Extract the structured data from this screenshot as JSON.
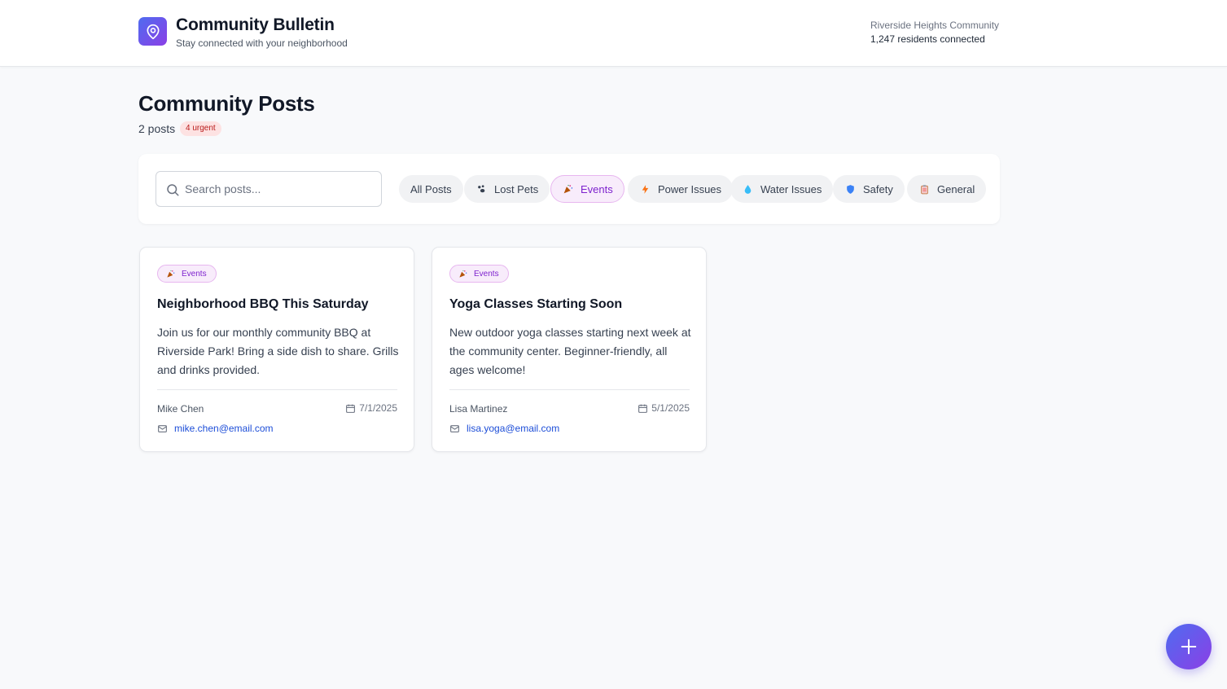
{
  "header": {
    "title": "Community Bulletin",
    "subtitle": "Stay connected with your neighborhood",
    "community_name": "Riverside Heights Community",
    "residents": "1,247 residents connected"
  },
  "main": {
    "title": "Community Posts",
    "post_count": "2 posts",
    "urgent_badge": "4 urgent"
  },
  "search": {
    "placeholder": "Search posts...",
    "value": ""
  },
  "filters": [
    {
      "label": "All Posts",
      "icon": "none",
      "active": false
    },
    {
      "label": "Lost Pets",
      "icon": "paw-icon",
      "active": false
    },
    {
      "label": "Events",
      "icon": "party-popper-icon",
      "active": true
    },
    {
      "label": "Power Issues",
      "icon": "lightning-icon",
      "active": false
    },
    {
      "label": "Water Issues",
      "icon": "droplet-icon",
      "active": false
    },
    {
      "label": "Safety",
      "icon": "shield-icon",
      "active": false
    },
    {
      "label": "General",
      "icon": "clipboard-icon",
      "active": false
    }
  ],
  "posts": [
    {
      "category": "Events",
      "title": "Neighborhood BBQ This Saturday",
      "body": "Join us for our monthly community BBQ at Riverside Park! Bring a side dish to share. Grills and drinks provided.",
      "author": "Mike Chen",
      "date": "7/1/2025",
      "email": "mike.chen@email.com"
    },
    {
      "category": "Events",
      "title": "Yoga Classes Starting Soon",
      "body": "New outdoor yoga classes starting next week at the community center. Beginner-friendly, all ages welcome!",
      "author": "Lisa Martinez",
      "date": "5/1/2025",
      "email": "lisa.yoga@email.com"
    }
  ],
  "colors": {
    "accent_start": "#4f6cf0",
    "accent_end": "#8b3fe6",
    "events_bg": "#f8ecfb",
    "events_text": "#7e22ce",
    "urgent_bg": "#fde2e2",
    "urgent_text": "#b91c1c",
    "link": "#1d4ed8"
  },
  "fab": {
    "icon": "plus-icon"
  }
}
